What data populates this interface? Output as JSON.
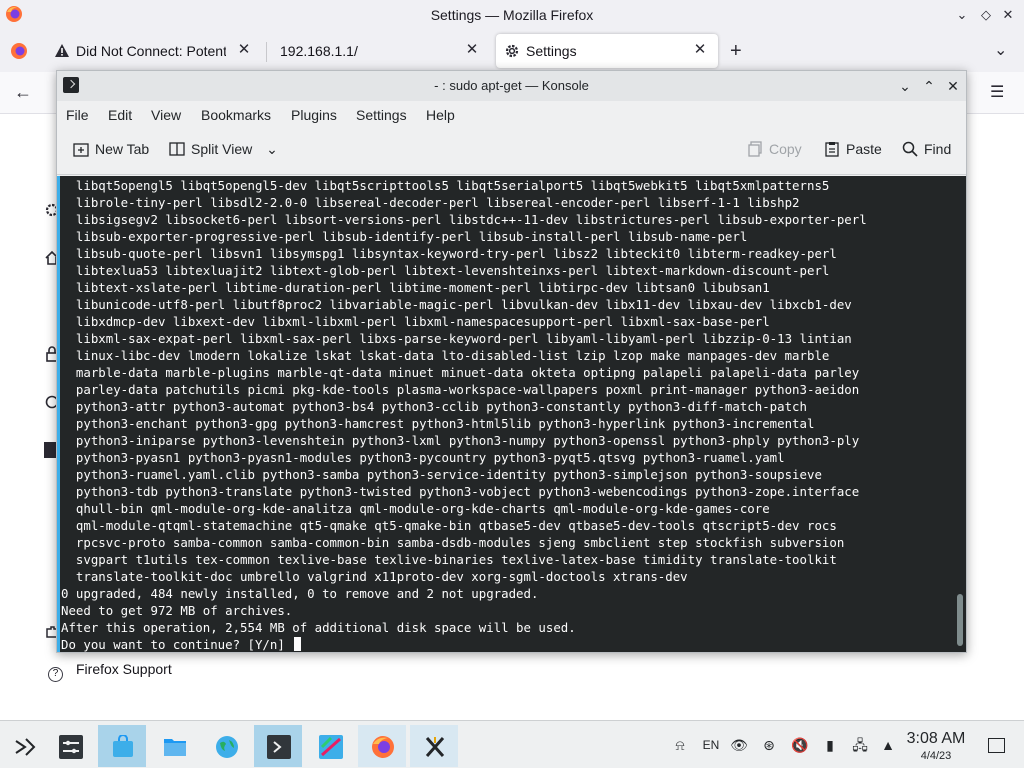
{
  "firefox": {
    "window_title": "Settings — Mozilla Firefox",
    "tabs": [
      {
        "label": "Did Not Connect: Potential",
        "icon": "warning-icon"
      },
      {
        "label": "192.168.1.1/",
        "icon": ""
      },
      {
        "label": "Settings",
        "icon": "gear-icon"
      }
    ],
    "support_link": "Firefox Support"
  },
  "konsole": {
    "window_title": "- : sudo apt-get — Konsole",
    "menu": [
      "File",
      "Edit",
      "View",
      "Bookmarks",
      "Plugins",
      "Settings",
      "Help"
    ],
    "toolbar": {
      "new_tab": "New Tab",
      "split_view": "Split View",
      "copy": "Copy",
      "paste": "Paste",
      "find": "Find"
    },
    "terminal_lines": [
      "  libqt5opengl5 libqt5opengl5-dev libqt5scripttools5 libqt5serialport5 libqt5webkit5 libqt5xmlpatterns5",
      "  librole-tiny-perl libsdl2-2.0-0 libsereal-decoder-perl libsereal-encoder-perl libserf-1-1 libshp2",
      "  libsigsegv2 libsocket6-perl libsort-versions-perl libstdc++-11-dev libstrictures-perl libsub-exporter-perl",
      "  libsub-exporter-progressive-perl libsub-identify-perl libsub-install-perl libsub-name-perl",
      "  libsub-quote-perl libsvn1 libsymspg1 libsyntax-keyword-try-perl libsz2 libteckit0 libterm-readkey-perl",
      "  libtexlua53 libtexluajit2 libtext-glob-perl libtext-levenshteinxs-perl libtext-markdown-discount-perl",
      "  libtext-xslate-perl libtime-duration-perl libtime-moment-perl libtirpc-dev libtsan0 libubsan1",
      "  libunicode-utf8-perl libutf8proc2 libvariable-magic-perl libvulkan-dev libx11-dev libxau-dev libxcb1-dev",
      "  libxdmcp-dev libxext-dev libxml-libxml-perl libxml-namespacesupport-perl libxml-sax-base-perl",
      "  libxml-sax-expat-perl libxml-sax-perl libxs-parse-keyword-perl libyaml-libyaml-perl libzzip-0-13 lintian",
      "  linux-libc-dev lmodern lokalize lskat lskat-data lto-disabled-list lzip lzop make manpages-dev marble",
      "  marble-data marble-plugins marble-qt-data minuet minuet-data okteta optipng palapeli palapeli-data parley",
      "  parley-data patchutils picmi pkg-kde-tools plasma-workspace-wallpapers poxml print-manager python3-aeidon",
      "  python3-attr python3-automat python3-bs4 python3-cclib python3-constantly python3-diff-match-patch",
      "  python3-enchant python3-gpg python3-hamcrest python3-html5lib python3-hyperlink python3-incremental",
      "  python3-iniparse python3-levenshtein python3-lxml python3-numpy python3-openssl python3-phply python3-ply",
      "  python3-pyasn1 python3-pyasn1-modules python3-pycountry python3-pyqt5.qtsvg python3-ruamel.yaml",
      "  python3-ruamel.yaml.clib python3-samba python3-service-identity python3-simplejson python3-soupsieve",
      "  python3-tdb python3-translate python3-twisted python3-vobject python3-webencodings python3-zope.interface",
      "  qhull-bin qml-module-org-kde-analitza qml-module-org-kde-charts qml-module-org-kde-games-core",
      "  qml-module-qtqml-statemachine qt5-qmake qt5-qmake-bin qtbase5-dev qtbase5-dev-tools qtscript5-dev rocs",
      "  rpcsvc-proto samba-common samba-common-bin samba-dsdb-modules sjeng smbclient step stockfish subversion",
      "  svgpart t1utils tex-common texlive-base texlive-binaries texlive-latex-base timidity translate-toolkit",
      "  translate-toolkit-doc umbrello valgrind x11proto-dev xorg-sgml-doctools xtrans-dev",
      "0 upgraded, 484 newly installed, 0 to remove and 2 not upgraded.",
      "Need to get 972 MB of archives.",
      "After this operation, 2,554 MB of additional disk space will be used.",
      "Do you want to continue? [Y/n] "
    ]
  },
  "taskbar": {
    "apps": [
      {
        "name": "application-launcher"
      },
      {
        "name": "system-settings"
      },
      {
        "name": "discover-store"
      },
      {
        "name": "dolphin-files"
      },
      {
        "name": "globe-browser"
      },
      {
        "name": "konsole-terminal"
      },
      {
        "name": "krita-image"
      },
      {
        "name": "firefox"
      },
      {
        "name": "xfce-x"
      }
    ],
    "keyboard_layout": "EN",
    "clock_time": "3:08 AM",
    "clock_date": "4/4/23"
  },
  "colors": {
    "terminal_bg": "#232627",
    "terminal_fg": "#fcfcfc",
    "accent": "#3daee9",
    "taskbar_active": "#a9d3ea"
  }
}
